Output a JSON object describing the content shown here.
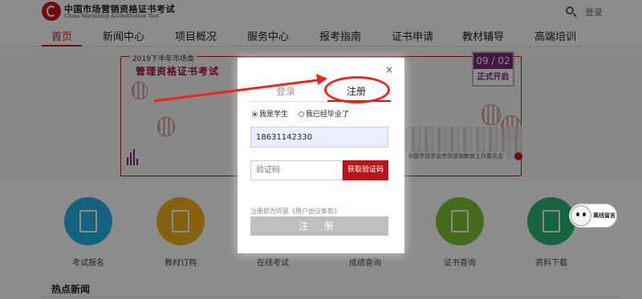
{
  "header": {
    "logo_cn": "中国市场营销资格证书考试",
    "logo_en": "China Marketing Accreditation Test",
    "login": "登录",
    "search_icon": "search-icon"
  },
  "nav": {
    "items": [
      {
        "label": "首页"
      },
      {
        "label": "新闻中心"
      },
      {
        "label": "项目概况"
      },
      {
        "label": "服务中心"
      },
      {
        "label": "报考指南"
      },
      {
        "label": "证书申请"
      },
      {
        "label": "教材辅导"
      },
      {
        "label": "高端培训"
      }
    ],
    "active_index": 0,
    "active_color": "#c9161d"
  },
  "banner": {
    "title_line1": "2019下半年市场类",
    "title_line2": "管理资格证书考试",
    "date": "09 / 02",
    "date_sub": "正式开启",
    "org": "中国市场学会市场营销教育工作委员会"
  },
  "services": [
    {
      "label": "考试报名",
      "color": "#25b3e8"
    },
    {
      "label": "教材订购",
      "color": "#f2b21e"
    },
    {
      "label": "在线考试",
      "color": "#e94b78"
    },
    {
      "label": "成绩查询",
      "color": "#8b54c0"
    },
    {
      "label": "证书查询",
      "color": "#7dc232"
    },
    {
      "label": "资料下载",
      "color": "#2bb673"
    }
  ],
  "hot_news": "热点新闻",
  "chat": {
    "label": "离线留言"
  },
  "modal": {
    "close": "×",
    "tab_login": "登录",
    "tab_register": "注册",
    "radio_student": "我是学生",
    "radio_graduated": "我已经毕业了",
    "selected_radio": "student",
    "phone_value": "18631142330",
    "code_placeholder": "验证码",
    "code_button": "获取验证码",
    "agreement": "注册即为同意《用户协议条款》",
    "register_button": "注 册",
    "accent": "#b8141a",
    "annotation_color": "#e8281f"
  }
}
